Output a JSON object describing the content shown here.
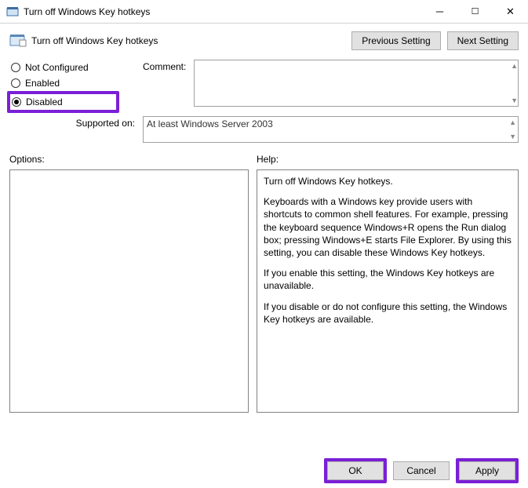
{
  "window": {
    "title": "Turn off Windows Key hotkeys"
  },
  "header": {
    "policy_title": "Turn off Windows Key hotkeys",
    "prev_setting": "Previous Setting",
    "next_setting": "Next Setting"
  },
  "radios": {
    "not_configured": "Not Configured",
    "enabled": "Enabled",
    "disabled": "Disabled",
    "selected": "disabled"
  },
  "labels": {
    "comment": "Comment:",
    "supported_on": "Supported on:",
    "options": "Options:",
    "help": "Help:"
  },
  "fields": {
    "comment_value": "",
    "supported_value": "At least Windows Server 2003"
  },
  "help": {
    "p1": "Turn off Windows Key hotkeys.",
    "p2": "Keyboards with a Windows key provide users with shortcuts to common shell features. For example, pressing the keyboard sequence Windows+R opens the Run dialog box; pressing Windows+E starts File Explorer. By using this setting, you can disable these Windows Key hotkeys.",
    "p3": "If you enable this setting, the Windows Key hotkeys are unavailable.",
    "p4": "If you disable or do not configure this setting, the Windows Key hotkeys are available."
  },
  "buttons": {
    "ok": "OK",
    "cancel": "Cancel",
    "apply": "Apply"
  }
}
